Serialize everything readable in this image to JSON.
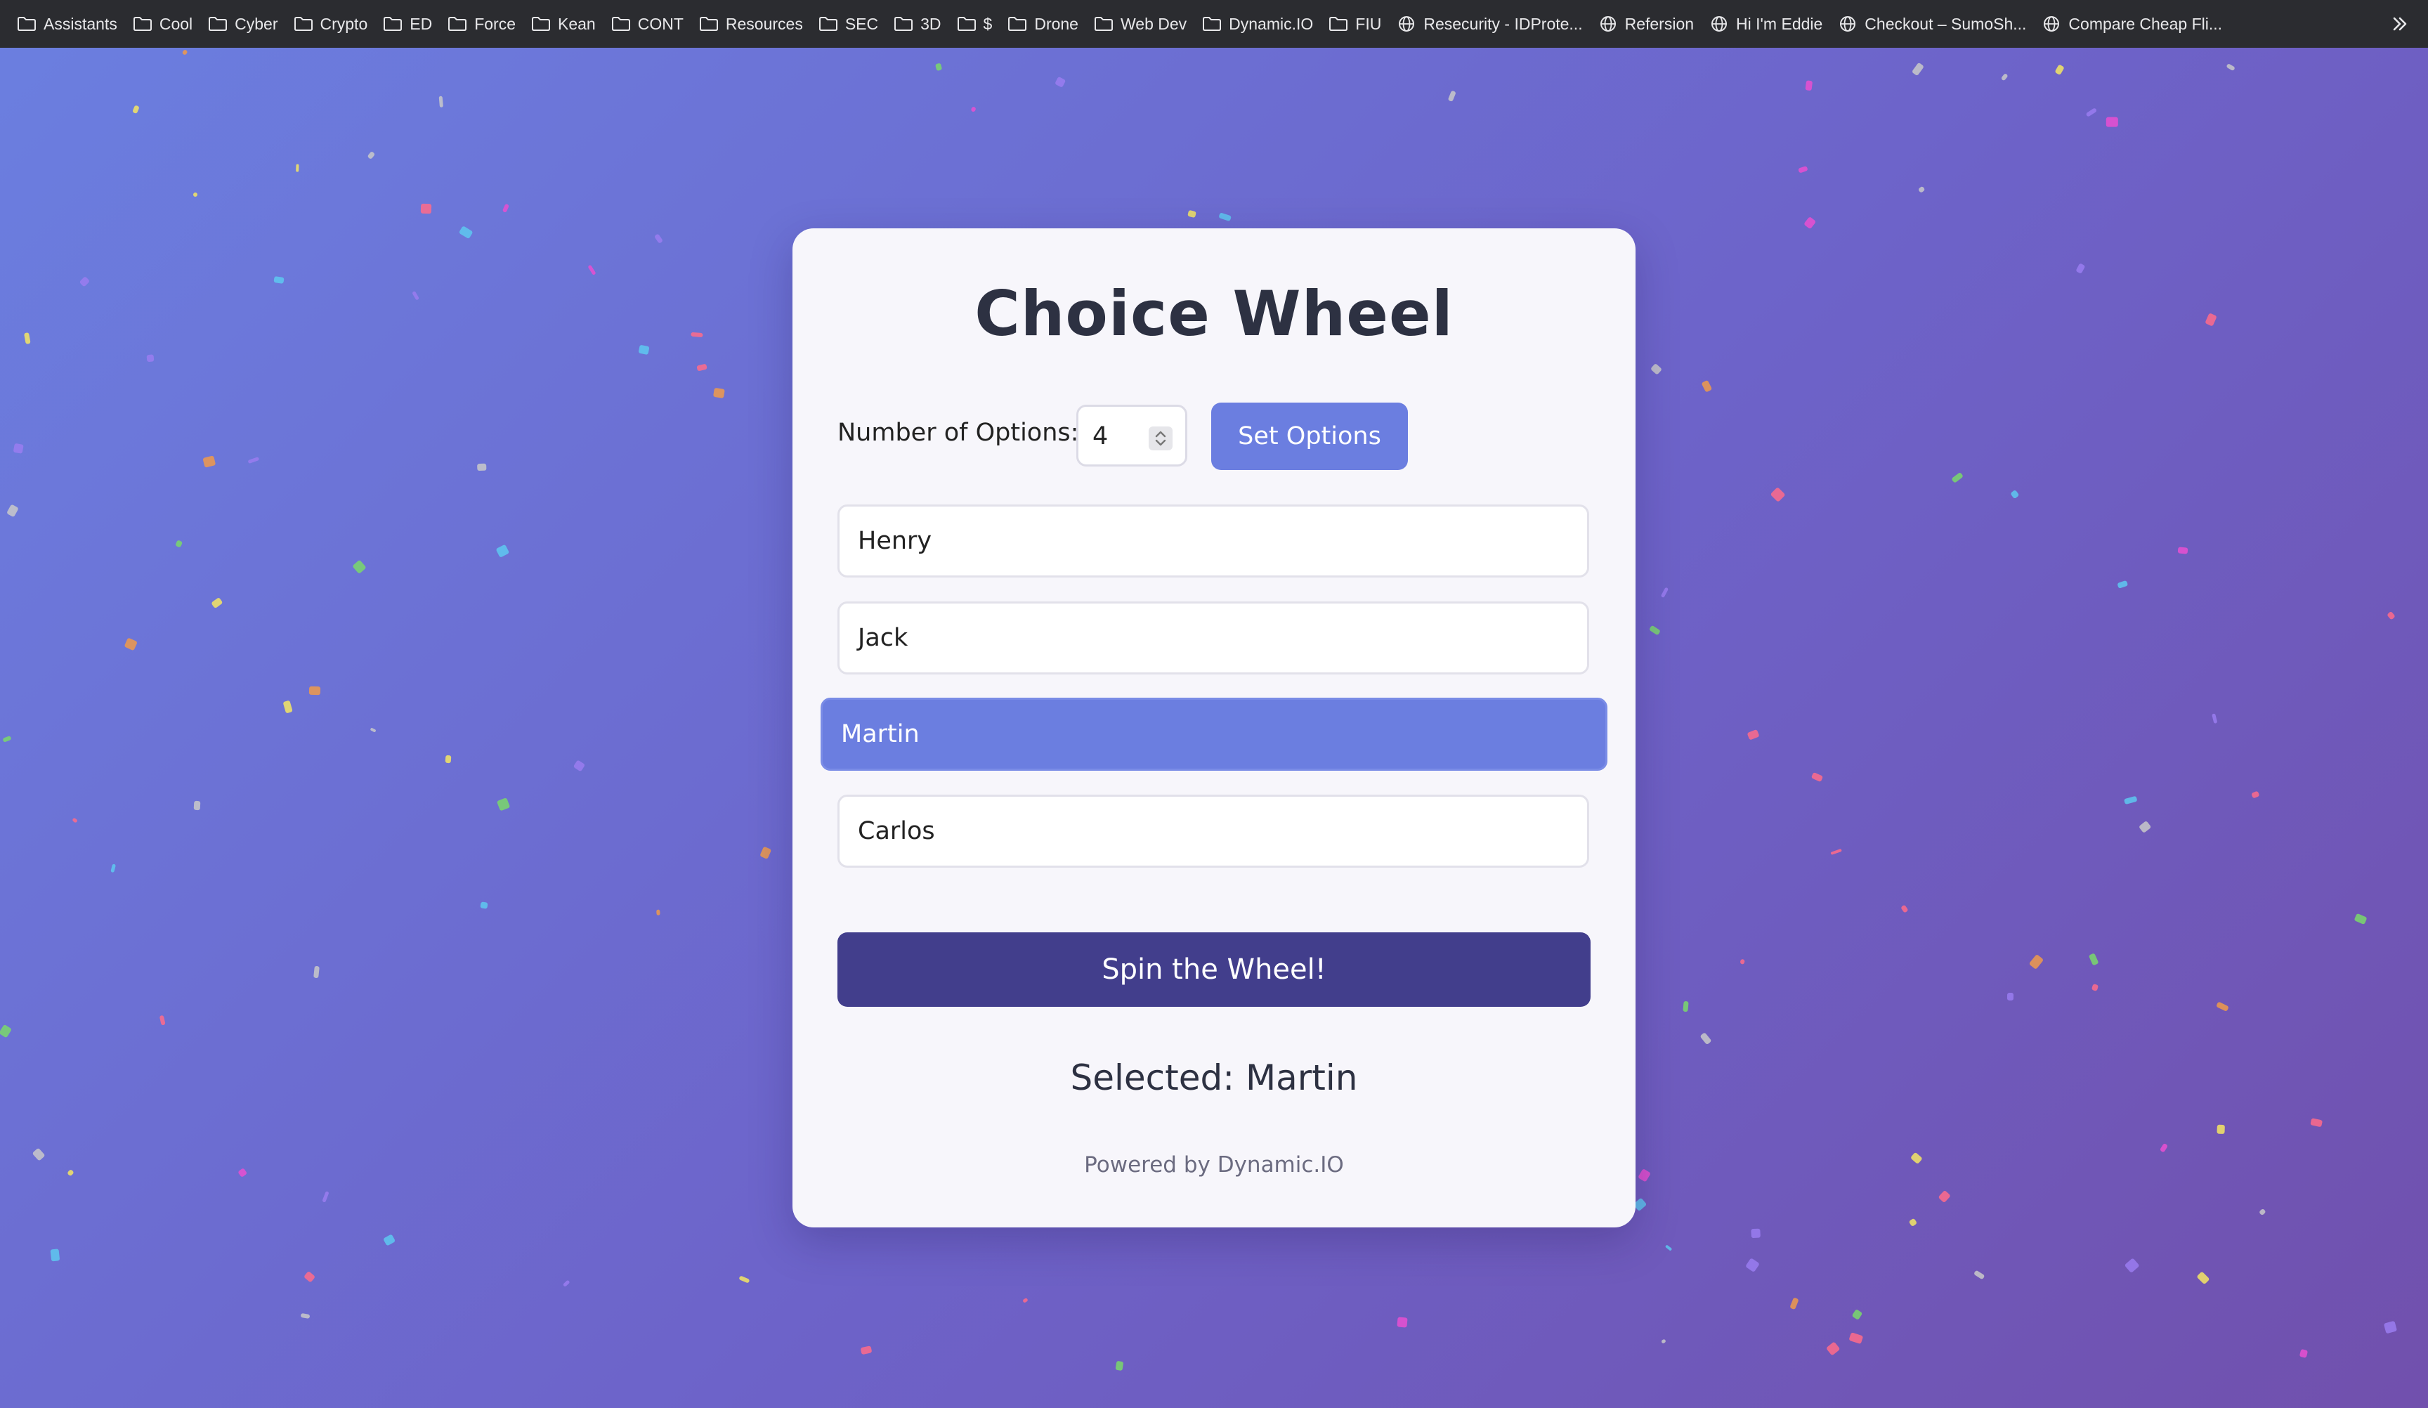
{
  "bookmarks": [
    {
      "label": "Assistants",
      "icon": "folder-icon"
    },
    {
      "label": "Cool",
      "icon": "folder-icon"
    },
    {
      "label": "Cyber",
      "icon": "folder-icon"
    },
    {
      "label": "Crypto",
      "icon": "folder-icon"
    },
    {
      "label": "ED",
      "icon": "folder-icon"
    },
    {
      "label": "Force",
      "icon": "folder-icon"
    },
    {
      "label": "Kean",
      "icon": "folder-icon"
    },
    {
      "label": "CONT",
      "icon": "folder-icon"
    },
    {
      "label": "Resources",
      "icon": "folder-icon"
    },
    {
      "label": "SEC",
      "icon": "folder-icon"
    },
    {
      "label": "3D",
      "icon": "folder-icon"
    },
    {
      "label": "$",
      "icon": "folder-icon"
    },
    {
      "label": "Drone",
      "icon": "folder-icon"
    },
    {
      "label": "Web Dev",
      "icon": "folder-icon"
    },
    {
      "label": "Dynamic.IO",
      "icon": "folder-icon"
    },
    {
      "label": "FIU",
      "icon": "folder-icon"
    },
    {
      "label": "Resecurity - IDProte...",
      "icon": "globe-icon"
    },
    {
      "label": "Refersion",
      "icon": "globe-icon"
    },
    {
      "label": "Hi I'm Eddie",
      "icon": "globe-icon"
    },
    {
      "label": "Checkout – SumoSh...",
      "icon": "globe-icon"
    },
    {
      "label": "Compare Cheap Fli...",
      "icon": "globe-icon"
    }
  ],
  "app": {
    "title": "Choice Wheel",
    "num_options_label": "Number of Options:",
    "num_options_value": "4",
    "set_options_label": "Set Options",
    "options": [
      "Henry",
      "Jack",
      "Martin",
      "Carlos"
    ],
    "selected_index": 2,
    "spin_label": "Spin the Wheel!",
    "selected_text": "Selected: Martin",
    "powered_by": "Powered by Dynamic.IO"
  },
  "colors": {
    "accent": "#6b7ee0",
    "spin_button": "#423e8c",
    "card": "#f7f6fb",
    "bookmarks_bar": "#2b2c30"
  }
}
